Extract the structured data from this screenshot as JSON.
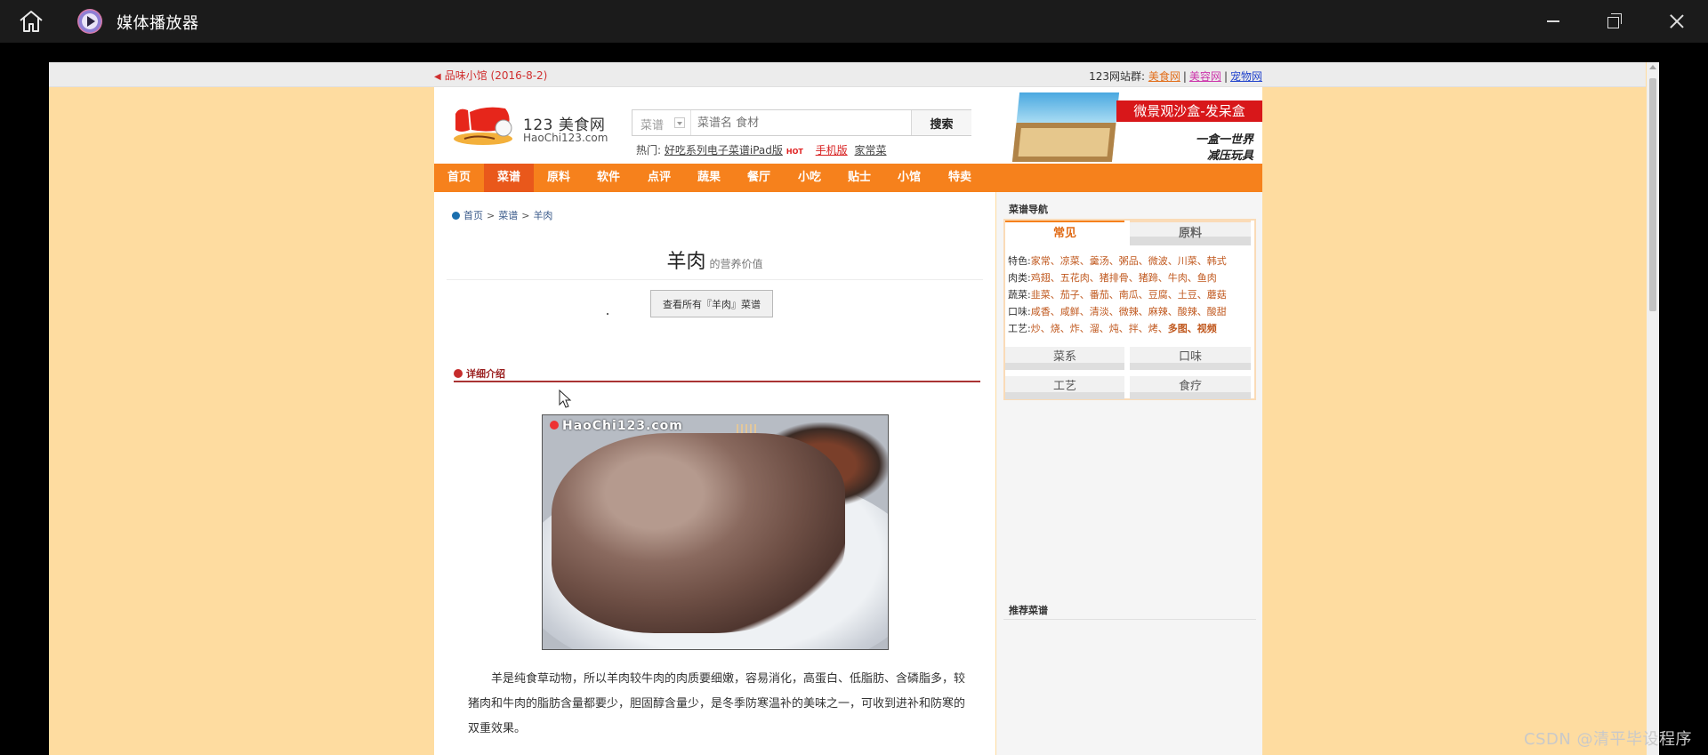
{
  "window": {
    "title": "媒体播放器"
  },
  "topbar": {
    "news": "品味小馆 (2016-8-2)",
    "sites_label": "123网站群:",
    "sites": [
      "美食网",
      "美容网",
      "宠物网"
    ],
    "sep": "|"
  },
  "header": {
    "site_name": "123 美食网",
    "site_domain": "HaoChi123.com",
    "search": {
      "select_value": "菜谱",
      "placeholder": "菜谱名 食材",
      "button": "搜索"
    },
    "hot_label": "热门:",
    "hot_links": [
      "好吃系列电子菜谱iPad版",
      "手机版",
      "家常菜"
    ],
    "hot_badge": "HOT",
    "banner": {
      "tag": "微景观沙盒-发呆盒",
      "slogan1": "一盒一世界",
      "slogan2": "减压玩具"
    }
  },
  "nav": {
    "items": [
      "首页",
      "菜谱",
      "原料",
      "软件",
      "点评",
      "蔬果",
      "餐厅",
      "小吃",
      "贴士",
      "小馆",
      "特卖"
    ],
    "active": "菜谱"
  },
  "main": {
    "breadcrumb": [
      "首页",
      "菜谱",
      "羊肉"
    ],
    "breadcrumb_sep": ">",
    "title": "羊肉",
    "title_sub": "的营养价值",
    "view_all_button": "查看所有『羊肉』菜谱",
    "section_title": "详细介绍",
    "photo_watermark": "HaoChi123.com",
    "paragraph": "羊是纯食草动物，所以羊肉较牛肉的肉质要细嫩，容易消化，高蛋白、低脂肪、含磷脂多，较猪肉和牛肉的脂肪含量都要少，胆固醇含量少，是冬季防寒温补的美味之一，可收到进补和防寒的双重效果。"
  },
  "sidebar": {
    "title": "菜谱导航",
    "tabs": [
      "常见",
      "原料"
    ],
    "categories": [
      {
        "label": "特色:",
        "items": "家常、凉菜、羹汤、粥品、微波、川菜、韩式"
      },
      {
        "label": "肉类:",
        "items": "鸡翅、五花肉、猪排骨、猪蹄、牛肉、鱼肉"
      },
      {
        "label": "蔬菜:",
        "items": "韭菜、茄子、番茄、南瓜、豆腐、土豆、蘑菇"
      },
      {
        "label": "口味:",
        "items": "咸香、咸鲜、清淡、微辣、麻辣、酸辣、酸甜"
      },
      {
        "label": "工艺:",
        "items": "炒、烧、炸、溜、炖、拌、烤、",
        "bold_items": "多图、视频"
      }
    ],
    "buttons": [
      "菜系",
      "口味",
      "工艺",
      "食疗"
    ],
    "recommend_title": "推荐菜谱"
  },
  "footer_watermark": "CSDN @清平毕设程序",
  "colors": {
    "page_bg": "#fedca0",
    "nav": "#f6811c",
    "nav_active": "#e9581b",
    "titlebar": "#1b1b1b",
    "banner_red": "#d8171a"
  }
}
